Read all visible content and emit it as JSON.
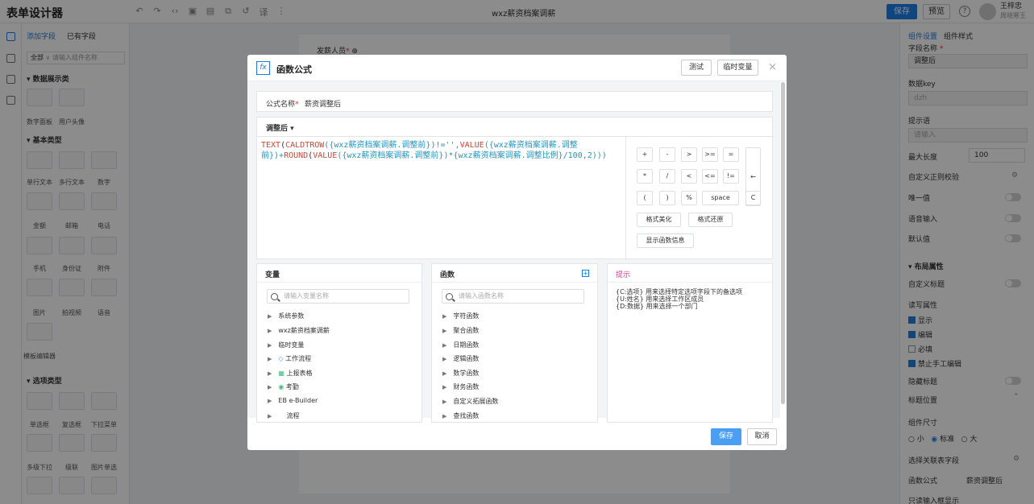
{
  "app": {
    "title": "表单设计器",
    "form_name": "wxz薪资档案调薪",
    "save_label": "保存",
    "preview_label": "预览",
    "help_icon": "question-icon",
    "user_name": "王梓忠",
    "user_sub": "周晓寒王"
  },
  "left_panel": {
    "tabs": [
      "添加字段",
      "已有字段"
    ],
    "filter_value": "全部",
    "filter_placeholder": "请输入组件名称",
    "categories": [
      {
        "title": "▾ 数据展示类",
        "items": [
          "数字面板",
          "用户头像"
        ]
      },
      {
        "title": "▾ 基本类型",
        "items": [
          "单行文本",
          "多行文本",
          "数字",
          "金额",
          "邮箱",
          "电话",
          "手机",
          "身份证",
          "附件",
          "图片",
          "拍视频",
          "语音",
          "模板编辑器"
        ]
      },
      {
        "title": "▾ 选项类型",
        "items": [
          "单选框",
          "复选框",
          "下拉菜单",
          "多级下拉",
          "级联",
          "图片单选"
        ]
      }
    ]
  },
  "canvas": {
    "field_label": "发薪人员"
  },
  "right_panel": {
    "tabs": [
      "组件设置",
      "组件样式"
    ],
    "field_name_label": "字段名称",
    "field_name_value": "调整后",
    "data_key_label": "数据key",
    "data_key_value": "dzh",
    "hint_label": "提示语",
    "hint_placeholder": "请输入",
    "max_length_label": "最大长度",
    "max_length_value": "100",
    "regex_label": "自定义正则校验",
    "unique_label": "唯一值",
    "voice_label": "语音输入",
    "default_label": "默认值",
    "layout_label": "▾ 布局属性",
    "custom_title_label": "自定义标题",
    "rw_label": "读写属性",
    "checks": [
      {
        "label": "显示",
        "checked": true
      },
      {
        "label": "编辑",
        "checked": true
      },
      {
        "label": "必填",
        "checked": false
      },
      {
        "label": "禁止手工编辑",
        "checked": true
      }
    ],
    "hide_title_label": "隐藏标题",
    "title_pos_label": "标题位置",
    "size_label": "组件尺寸",
    "sizes": [
      "小",
      "标准",
      "大"
    ],
    "linked_label": "选择关联表字段",
    "func_formula_label": "函数公式",
    "func_formula_value": "薪资调整后",
    "readonly_label": "只读输入框显示"
  },
  "modal": {
    "title": "函数公式",
    "test_label": "测试",
    "temp_var_label": "临时变量",
    "formula_name_label": "公式名称",
    "formula_name_value": "薪资调整后",
    "formula_field": "调整后 ▾",
    "formula": {
      "p1": "TEXT",
      "p2": "(",
      "p3": "CALDTROW",
      "p4": "({wxz薪资档案调薪.调整前})!='',",
      "p5": "VALUE",
      "p6": "({wxz薪资档案调薪.调整前})+",
      "p7": "ROUND",
      "p8": "(",
      "p9": "VALUE",
      "p10": "({wxz薪资档案调薪.调整前})*{wxz薪资档案调薪.调整比例}/100,2)))"
    },
    "keys_row1": [
      "+",
      "-",
      ">",
      ">=",
      "="
    ],
    "keys_row2": [
      "*",
      "/",
      "<",
      "<=",
      "!="
    ],
    "keys_row3": [
      "(",
      ")",
      "%",
      "space",
      "C"
    ],
    "backspace": "←",
    "format_beautify": "格式美化",
    "format_restore": "格式还原",
    "show_func_info": "显示函数信息",
    "variables": {
      "title": "变量",
      "search_placeholder": "请输入变量名称",
      "items": [
        "系统参数",
        "wxz薪资档案调薪",
        "临时变量",
        "工作流程",
        "上报表格",
        "考勤",
        "EB e-Builder",
        "流程"
      ]
    },
    "functions": {
      "title": "函数",
      "search_placeholder": "请输入函数名称",
      "items": [
        "字符函数",
        "聚合函数",
        "日期函数",
        "逻辑函数",
        "数学函数",
        "财务函数",
        "自定义拓展函数",
        "查找函数"
      ]
    },
    "tips": {
      "title": "提示",
      "lines": [
        "{C:选项} 用来选择特定选项字段下的备选项",
        "{U:姓名} 用来选择工作区成员",
        "{D:数据} 用来选择一个部门"
      ]
    },
    "save_label": "保存",
    "cancel_label": "取消"
  }
}
